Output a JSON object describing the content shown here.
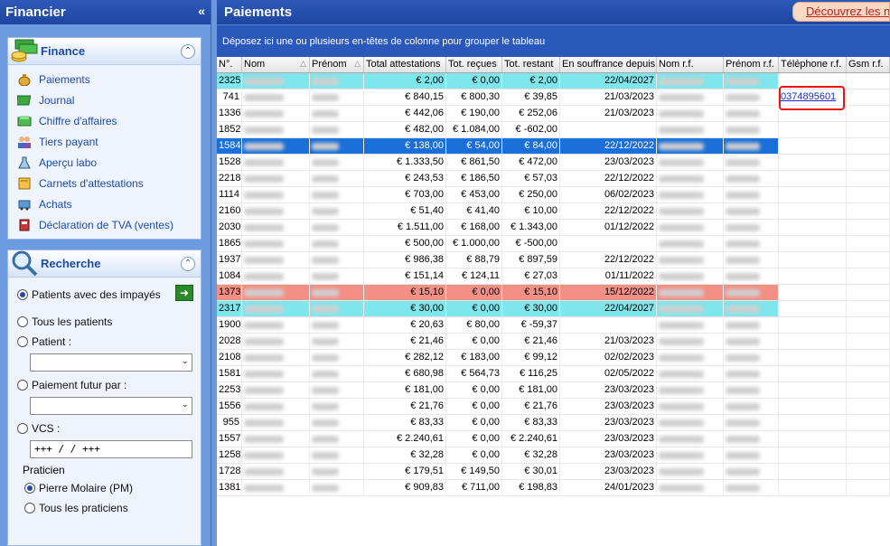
{
  "sidebar": {
    "title": "Financier",
    "collapse_glyph": "«",
    "finance": {
      "title": "Finance",
      "items": [
        {
          "label": "Paiements",
          "icon": "money-bag-icon"
        },
        {
          "label": "Journal",
          "icon": "book-icon"
        },
        {
          "label": "Chiffre d'affaires",
          "icon": "chart-icon"
        },
        {
          "label": "Tiers payant",
          "icon": "people-icon"
        },
        {
          "label": "Aperçu labo",
          "icon": "flask-icon"
        },
        {
          "label": "Carnets d'attestations",
          "icon": "notebook-icon"
        },
        {
          "label": "Achats",
          "icon": "cart-icon"
        },
        {
          "label": "Déclaration de TVA (ventes)",
          "icon": "tax-icon"
        }
      ]
    },
    "search": {
      "title": "Recherche",
      "opt_unpaid": "Patients avec des impayés",
      "opt_all": "Tous les patients",
      "opt_patient": "Patient :",
      "opt_future": "Paiement futur par :",
      "opt_vcs": "VCS :",
      "vcs_value": "+++  /   /    +++",
      "praticien_label": "Praticien",
      "prac_1": "Pierre Molaire (PM)",
      "prac_all": "Tous les praticiens"
    }
  },
  "main": {
    "title": "Paiements",
    "discover_label": "Découvrez les n",
    "group_hint": "Déposez ici une ou plusieurs en-têtes de colonne pour grouper le tableau",
    "columns": [
      "N°.",
      "Nom",
      "Prénom",
      "Total attestations",
      "Tot. reçues",
      "Tot. restant",
      "En souffrance depuis",
      "Nom r.f.",
      "Prénom r.f.",
      "Téléphone r.f.",
      "Gsm r.f."
    ],
    "rows": [
      {
        "n": "2325",
        "total": "€ 2,00",
        "recues": "€ 0,00",
        "restant": "€ 2,00",
        "depuis": "22/04/2027",
        "phone": "",
        "style": "cyan"
      },
      {
        "n": "741",
        "total": "€ 840,15",
        "recues": "€ 800,30",
        "restant": "€ 39,85",
        "depuis": "21/03/2023",
        "phone": "0374895601",
        "style": ""
      },
      {
        "n": "1336",
        "total": "€ 442,06",
        "recues": "€ 190,00",
        "restant": "€ 252,06",
        "depuis": "21/03/2023",
        "phone": "",
        "style": ""
      },
      {
        "n": "1852",
        "total": "€ 482,00",
        "recues": "€ 1.084,00",
        "restant": "€ -602,00",
        "depuis": "",
        "phone": "",
        "style": ""
      },
      {
        "n": "1584",
        "total": "€ 138,00",
        "recues": "€ 54,00",
        "restant": "€ 84,00",
        "depuis": "22/12/2022",
        "phone": "",
        "style": "blue"
      },
      {
        "n": "1528",
        "total": "€ 1.333,50",
        "recues": "€ 861,50",
        "restant": "€ 472,00",
        "depuis": "23/03/2023",
        "phone": "",
        "style": ""
      },
      {
        "n": "2218",
        "total": "€ 243,53",
        "recues": "€ 186,50",
        "restant": "€ 57,03",
        "depuis": "22/12/2022",
        "phone": "",
        "style": ""
      },
      {
        "n": "1114",
        "total": "€ 703,00",
        "recues": "€ 453,00",
        "restant": "€ 250,00",
        "depuis": "06/02/2023",
        "phone": "",
        "style": ""
      },
      {
        "n": "2160",
        "total": "€ 51,40",
        "recues": "€ 41,40",
        "restant": "€ 10,00",
        "depuis": "22/12/2022",
        "phone": "",
        "style": ""
      },
      {
        "n": "2030",
        "total": "€ 1.511,00",
        "recues": "€ 168,00",
        "restant": "€ 1.343,00",
        "depuis": "01/12/2022",
        "phone": "",
        "style": ""
      },
      {
        "n": "1865",
        "total": "€ 500,00",
        "recues": "€ 1.000,00",
        "restant": "€ -500,00",
        "depuis": "",
        "phone": "",
        "style": ""
      },
      {
        "n": "1937",
        "total": "€ 986,38",
        "recues": "€ 88,79",
        "restant": "€ 897,59",
        "depuis": "22/12/2022",
        "phone": "",
        "style": ""
      },
      {
        "n": "1084",
        "total": "€ 151,14",
        "recues": "€ 124,11",
        "restant": "€ 27,03",
        "depuis": "01/11/2022",
        "phone": "",
        "style": ""
      },
      {
        "n": "1373",
        "total": "€ 15,10",
        "recues": "€ 0,00",
        "restant": "€ 15,10",
        "depuis": "15/12/2022",
        "phone": "",
        "style": "salmon"
      },
      {
        "n": "2317",
        "total": "€ 30,00",
        "recues": "€ 0,00",
        "restant": "€ 30,00",
        "depuis": "22/04/2027",
        "phone": "",
        "style": "cyan"
      },
      {
        "n": "1900",
        "total": "€ 20,63",
        "recues": "€ 80,00",
        "restant": "€ -59,37",
        "depuis": "",
        "phone": "",
        "style": ""
      },
      {
        "n": "2028",
        "total": "€ 21,46",
        "recues": "€ 0,00",
        "restant": "€ 21,46",
        "depuis": "21/03/2023",
        "phone": "",
        "style": ""
      },
      {
        "n": "2108",
        "total": "€ 282,12",
        "recues": "€ 183,00",
        "restant": "€ 99,12",
        "depuis": "02/02/2023",
        "phone": "",
        "style": ""
      },
      {
        "n": "1581",
        "total": "€ 680,98",
        "recues": "€ 564,73",
        "restant": "€ 116,25",
        "depuis": "02/05/2022",
        "phone": "",
        "style": ""
      },
      {
        "n": "2253",
        "total": "€ 181,00",
        "recues": "€ 0,00",
        "restant": "€ 181,00",
        "depuis": "23/03/2023",
        "phone": "",
        "style": ""
      },
      {
        "n": "1556",
        "total": "€ 21,76",
        "recues": "€ 0,00",
        "restant": "€ 21,76",
        "depuis": "23/03/2023",
        "phone": "",
        "style": ""
      },
      {
        "n": "955",
        "total": "€ 83,33",
        "recues": "€ 0,00",
        "restant": "€ 83,33",
        "depuis": "23/03/2023",
        "phone": "",
        "style": ""
      },
      {
        "n": "1557",
        "total": "€ 2.240,61",
        "recues": "€ 0,00",
        "restant": "€ 2.240,61",
        "depuis": "23/03/2023",
        "phone": "",
        "style": ""
      },
      {
        "n": "1258",
        "total": "€ 32,28",
        "recues": "€ 0,00",
        "restant": "€ 32,28",
        "depuis": "23/03/2023",
        "phone": "",
        "style": ""
      },
      {
        "n": "1728",
        "total": "€ 179,51",
        "recues": "€ 149,50",
        "restant": "€ 30,01",
        "depuis": "23/03/2023",
        "phone": "",
        "style": ""
      },
      {
        "n": "1381",
        "total": "€ 909,83",
        "recues": "€ 711,00",
        "restant": "€ 198,83",
        "depuis": "24/01/2023",
        "phone": "",
        "style": ""
      }
    ]
  }
}
